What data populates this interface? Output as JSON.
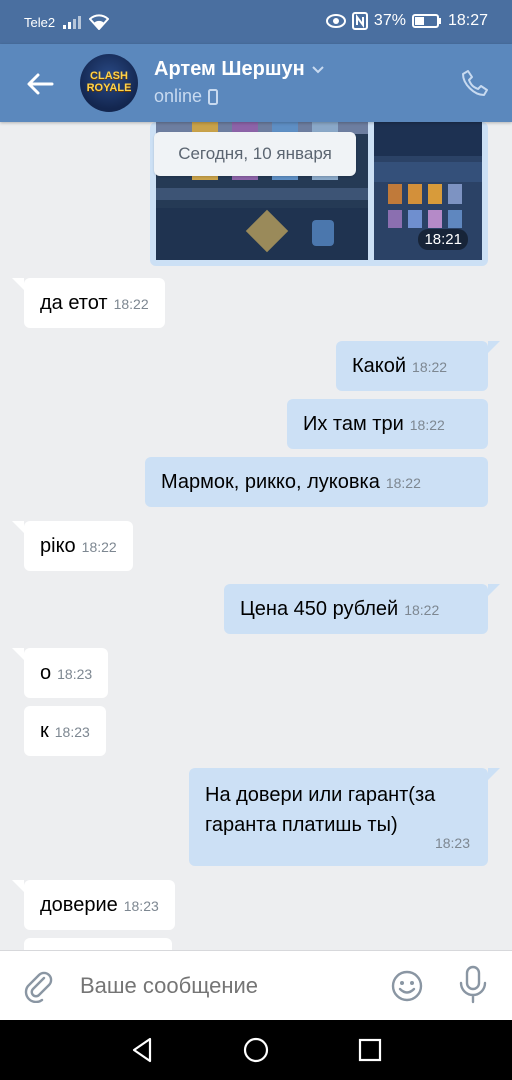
{
  "statusbar": {
    "carrier": "Tele2",
    "battery": "37%",
    "time": "18:27"
  },
  "header": {
    "name": "Артем Шершун",
    "status": "online",
    "avatar_text": "CLASH ROYALE"
  },
  "date_separator": "Сегодня, 10 января",
  "image_time": "18:21",
  "messages": [
    {
      "dir": "in",
      "text": "да етот",
      "time": "18:22"
    },
    {
      "dir": "out",
      "text": "Какой",
      "time": "18:22"
    },
    {
      "dir": "out",
      "text": "Их там три",
      "time": "18:22"
    },
    {
      "dir": "out",
      "text": "Мармок, рикко, луковка",
      "time": "18:22"
    },
    {
      "dir": "in",
      "text": "ріко",
      "time": "18:22"
    },
    {
      "dir": "out",
      "text": "Цена 450 рублей",
      "time": "18:22"
    },
    {
      "dir": "in",
      "text": "о",
      "time": "18:23"
    },
    {
      "dir": "in",
      "text": "к",
      "time": "18:23"
    },
    {
      "dir": "out",
      "text": "На довери или гарант(за гаранта платишь ты)",
      "line1": "На довери или гарант(за",
      "line2": "гаранта платишь ты)",
      "time": "18:23"
    },
    {
      "dir": "in",
      "text": "доверие",
      "time": "18:23"
    }
  ],
  "input": {
    "placeholder": "Ваше сообщение"
  },
  "colors": {
    "header": "#5b88bd",
    "statusbar": "#4a6fa0",
    "outgoing": "#cce0f5",
    "incoming": "#ffffff",
    "background": "#edeef0"
  },
  "icons": [
    "back-arrow-icon",
    "chevron-down-icon",
    "phone-icon",
    "mobile-icon",
    "paperclip-icon",
    "smile-icon",
    "microphone-icon",
    "nav-back-icon",
    "nav-home-icon",
    "nav-recents-icon"
  ]
}
